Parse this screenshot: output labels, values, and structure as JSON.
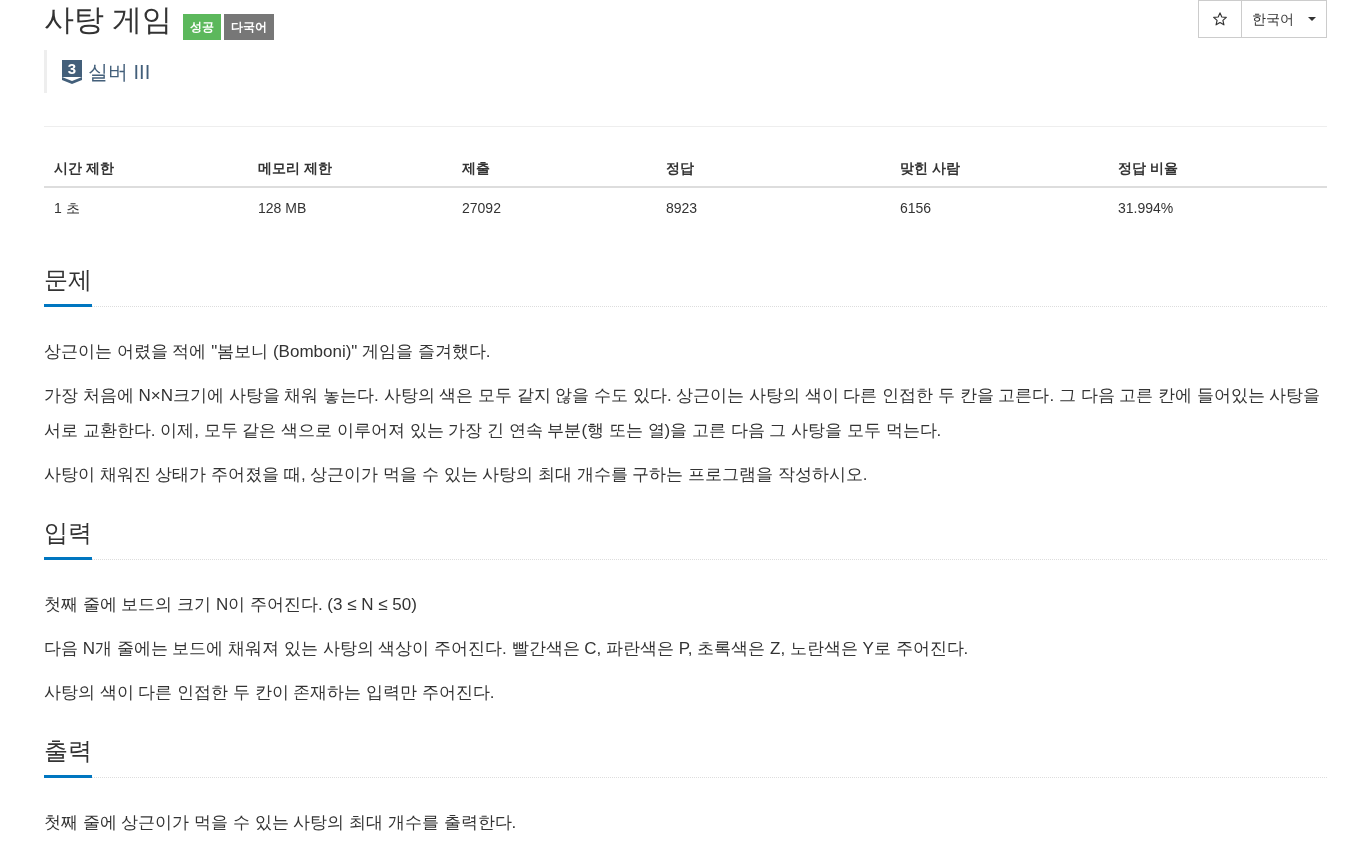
{
  "header": {
    "title": "사탕 게임",
    "labels": [
      {
        "text": "성공",
        "color": "#5cb85c"
      },
      {
        "text": "다국어",
        "color": "#777777"
      }
    ],
    "tier": {
      "number": "3",
      "name": "실버 III"
    }
  },
  "toolbar": {
    "starred": false,
    "language": "한국어"
  },
  "stats_table": {
    "columns": [
      "시간 제한",
      "메모리 제한",
      "제출",
      "정답",
      "맞힌 사람",
      "정답 비율"
    ],
    "rows": [
      [
        "1 초",
        "128 MB",
        "27092",
        "8923",
        "6156",
        "31.994%"
      ]
    ]
  },
  "sections": [
    {
      "title": "문제",
      "paragraphs": [
        "상근이는 어렸을 적에 \"봄보니 (Bomboni)\" 게임을 즐겨했다.",
        "가장 처음에 N×N크기에 사탕을 채워 놓는다. 사탕의 색은 모두 같지 않을 수도 있다. 상근이는 사탕의 색이 다른 인접한 두 칸을 고른다. 그 다음 고른 칸에 들어있는 사탕을 서로 교환한다. 이제, 모두 같은 색으로 이루어져 있는 가장 긴 연속 부분(행 또는 열)을 고른 다음 그 사탕을 모두 먹는다.",
        "사탕이 채워진 상태가 주어졌을 때, 상근이가 먹을 수 있는 사탕의 최대 개수를 구하는 프로그램을 작성하시오."
      ]
    },
    {
      "title": "입력",
      "paragraphs": [
        "첫째 줄에 보드의 크기 N이 주어진다. (3 ≤ N ≤ 50)",
        "다음 N개 줄에는 보드에 채워져 있는 사탕의 색상이 주어진다. 빨간색은 C, 파란색은 P, 초록색은 Z, 노란색은 Y로 주어진다.",
        "사탕의 색이 다른 인접한 두 칸이 존재하는 입력만 주어진다."
      ]
    },
    {
      "title": "출력",
      "paragraphs": [
        "첫째 줄에 상근이가 먹을 수 있는 사탕의 최대 개수를 출력한다."
      ]
    }
  ]
}
